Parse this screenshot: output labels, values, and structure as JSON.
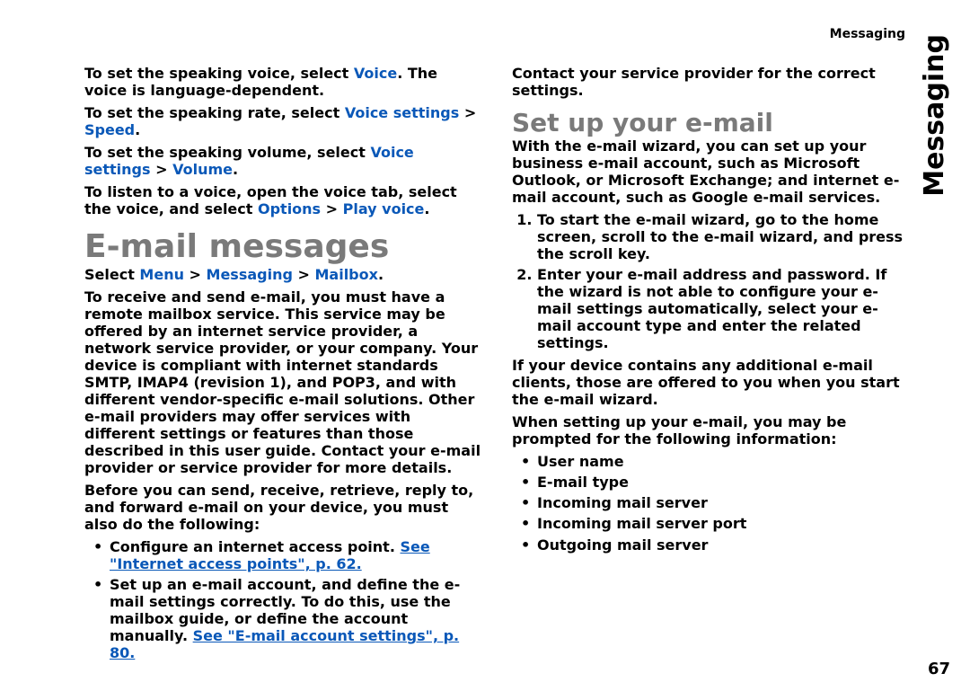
{
  "header": {
    "running": "Messaging",
    "side": "Messaging",
    "pagenum": "67"
  },
  "left": {
    "p1a": "To set the speaking voice, select ",
    "p1kw": "Voice",
    "p1b": ". The voice is language-dependent.",
    "p2a": "To set the speaking rate, select ",
    "p2k1": "Voice settings",
    "p2sep": "  >  ",
    "p2k2": "Speed",
    "p2end": ".",
    "p3a": "To set the speaking volume, select ",
    "p3k1": "Voice settings",
    "p3sep": "  >  ",
    "p3k2": "Volume",
    "p3end": ".",
    "p4a": "To listen to a voice, open the voice tab, select the voice, and select ",
    "p4k1": "Options",
    "p4sep": "  >  ",
    "p4k2": "Play voice",
    "p4end": ".",
    "h1": "E-mail messages",
    "p5a": "Select ",
    "p5k1": "Menu",
    "p5sep": "  >  ",
    "p5k2": "Messaging",
    "p5k3": "Mailbox",
    "p5end": ".",
    "p6": "To receive and send e-mail, you must have a remote mailbox service. This service may be offered by an internet service provider, a network service provider, or your company. Your device is compliant with internet standards SMTP, IMAP4 (revision 1), and POP3, and with different vendor-specific e-mail solutions. Other e-mail providers may offer services with different settings or features than those described in this user guide. Contact your e-mail provider or service provider for more details.",
    "p7": "Before you can send, receive, retrieve, reply to, and forward e-mail on your device, you must also do the following:",
    "b1a": "Configure an internet access point. ",
    "b1x": "See \"Internet access points\", p. 62.",
    "b2a": "Set up an e-mail account, and define the e-mail settings correctly. To do this, use the mailbox guide, or define the account manually. ",
    "b2x": "See \"E-mail account settings\", p. 80.",
    "p8": "Contact your service provider for the correct settings."
  },
  "right": {
    "h2": "Set up your e-mail",
    "p1": "With the e-mail wizard, you can set up your business e-mail account, such as Microsoft Outlook, or Microsoft Exchange; and internet e-mail account, such as Google e-mail services.",
    "n1": "To start the e-mail wizard, go to the home screen, scroll to the e-mail wizard, and press the scroll key.",
    "n2": "Enter your e-mail address and password. If the wizard is not able to configure your e-mail settings automatically, select your e-mail account type and enter the related settings.",
    "p2": "If your device contains any additional e-mail clients, those are offered to you when you start the e-mail wizard.",
    "p3": "When setting up your e-mail, you may be prompted for the following information:",
    "i1": "User name",
    "i2": "E-mail type",
    "i3": "Incoming mail server",
    "i4": "Incoming mail server port",
    "i5": "Outgoing mail server"
  }
}
